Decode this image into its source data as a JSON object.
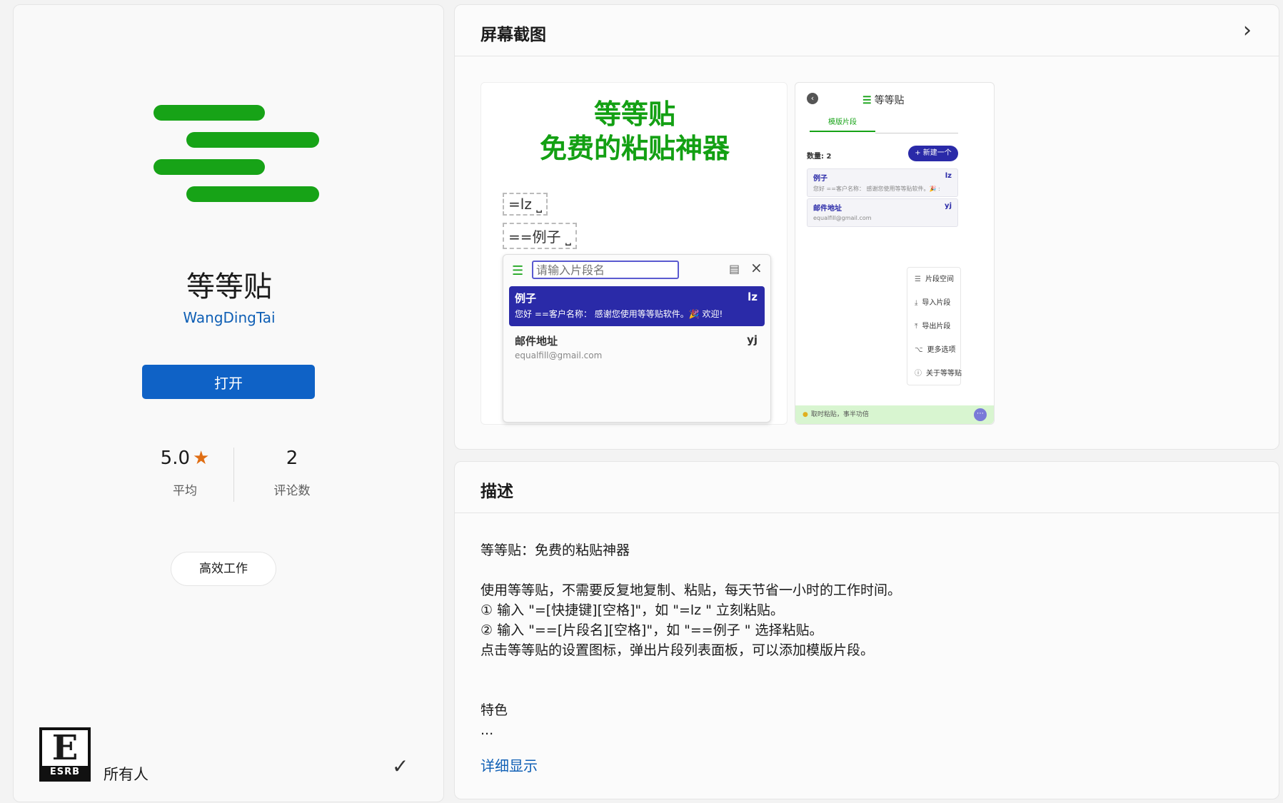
{
  "app": {
    "name": "等等贴",
    "publisher": "WangDingTai",
    "open_label": "打开",
    "rating_value": "5.0",
    "rating_label": "平均",
    "reviews_count": "2",
    "reviews_label": "评论数",
    "category": "高效工作",
    "age_rating_text": "所有人",
    "esrb_letter": "E",
    "esrb_word": "ESRB",
    "logo_color": "#17a317",
    "accent_color": "#0f62c6"
  },
  "screenshots": {
    "title": "屏幕截图",
    "shot1": {
      "headline_line1": "等等贴",
      "headline_line2": "免费的粘贴神器",
      "shortcut_example": "=lz ⎵",
      "snippet_example": "==例子 ⎵",
      "search_placeholder": "请输入片段名",
      "snippets": [
        {
          "name": "例子",
          "key": "lz",
          "body": "您好 ==客户名称： 感谢您使用等等贴软件。🎉 欢迎!"
        },
        {
          "name": "邮件地址",
          "key": "yj",
          "body": "equalfill@gmail.com"
        }
      ]
    },
    "shot2": {
      "title": "等等贴",
      "tab": "模版片段",
      "count_label": "数量: 2",
      "new_button": "+ 新建一个",
      "items": [
        {
          "name": "例子",
          "key": "lz",
          "body": "您好 ==客户名称： 感谢您使用等等贴软件。🎉 :"
        },
        {
          "name": "邮件地址",
          "key": "yj",
          "body": "equalfill@gmail.com"
        }
      ],
      "menu": [
        "片段空间",
        "导入片段",
        "导出片段",
        "更多选项",
        "关于等等贴"
      ],
      "status": "取时粘贴，事半功倍"
    }
  },
  "description": {
    "title": "描述",
    "intro": "等等贴：免费的粘贴神器",
    "line1": "使用等等贴，不需要反复地复制、粘贴，每天节省一小时的工作时间。",
    "line2": "① 输入 \"=[快捷键][空格]\"，如 \"=lz \" 立刻粘贴。",
    "line3": "② 输入 \"==[片段名][空格]\"，如 \"==例子 \" 选择粘贴。",
    "line4": "点击等等贴的设置图标，弹出片段列表面板，可以添加模版片段。",
    "features_heading": "特色",
    "ellipsis": "...",
    "show_more": "详细显示"
  }
}
